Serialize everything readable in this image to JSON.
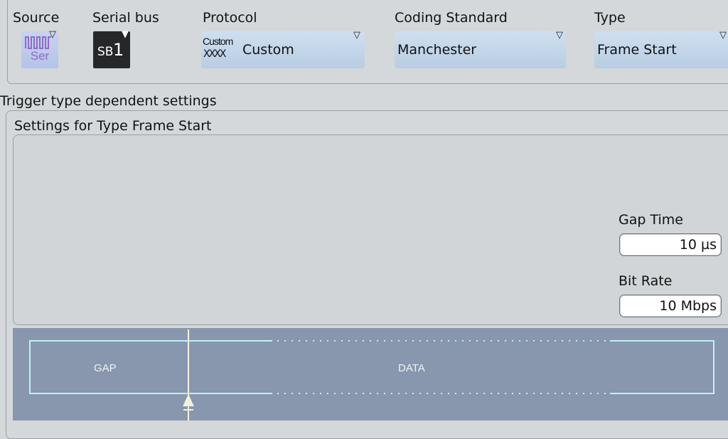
{
  "header": {
    "source_label": "Source",
    "serial_bus_label": "Serial bus",
    "protocol_label": "Protocol",
    "coding_label": "Coding Standard",
    "type_label": "Type"
  },
  "source": {
    "icon_text": "Ser"
  },
  "serial_bus": {
    "prefix": "SB",
    "number": "1"
  },
  "protocol": {
    "icon_top": "Custom",
    "icon_bottom": "XXXX",
    "value": "Custom"
  },
  "coding": {
    "value": "Manchester"
  },
  "type": {
    "value": "Frame Start"
  },
  "section_title": "Trigger type dependent settings",
  "settings_title": "Settings for Type Frame Start",
  "gap_time": {
    "label": "Gap Time",
    "value": "10 µs"
  },
  "bit_rate": {
    "label": "Bit Rate",
    "value": "10 Mbps"
  },
  "diagram": {
    "gap_label": "GAP",
    "data_label": "DATA"
  },
  "colors": {
    "diagram_bg": "#8897ad",
    "diagram_line": "#bff2f0",
    "combo": "#c3d6ea"
  }
}
